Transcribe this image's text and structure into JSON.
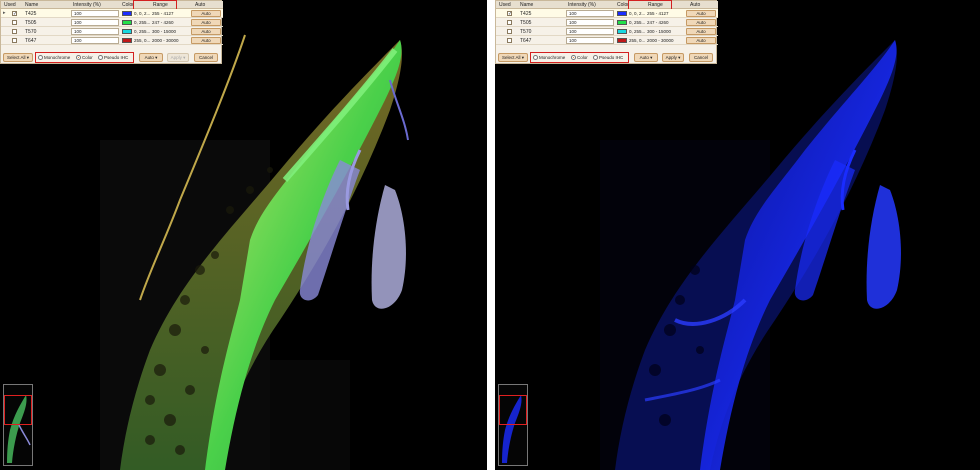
{
  "columns": {
    "used": "Used",
    "name": "Name",
    "intensity": "Intensity (%)",
    "color": "Color",
    "range": "Range",
    "auto": "Auto"
  },
  "panels": [
    {
      "id": "left",
      "rows": [
        {
          "name": "T425",
          "checked": true,
          "intensity": "100",
          "swatch": "#1a2cff",
          "color_value": "0, 0, 2...",
          "range": "255 - 4127",
          "auto": "Auto"
        },
        {
          "name": "T505",
          "checked": false,
          "intensity": "100",
          "swatch": "#22e04a",
          "color_value": "0, 255...",
          "range": "247 - 4260",
          "auto": "Auto"
        },
        {
          "name": "T570",
          "checked": false,
          "intensity": "100",
          "swatch": "#18d8e0",
          "color_value": "0, 255...",
          "range": "300 - 15000",
          "auto": "Auto"
        },
        {
          "name": "T647",
          "checked": false,
          "intensity": "100",
          "swatch": "#c01818",
          "color_value": "255, 0...",
          "range": "2000 - 30000",
          "auto": "Auto"
        }
      ],
      "radios": {
        "mono": "Monochrome",
        "color": "Color",
        "pseudo": "Pseudo IHC",
        "selected": "color"
      },
      "buttons": {
        "select_all": "Select All",
        "auto": "Auto",
        "apply": "Apply",
        "cancel": "Cancel"
      }
    },
    {
      "id": "right",
      "rows": [
        {
          "name": "T425",
          "checked": true,
          "intensity": "100",
          "swatch": "#1a2cff",
          "color_value": "0, 0, 2...",
          "range": "255 - 4127",
          "auto": "Auto"
        },
        {
          "name": "T505",
          "checked": false,
          "intensity": "100",
          "swatch": "#22e04a",
          "color_value": "0, 255...",
          "range": "247 - 4260",
          "auto": "Auto"
        },
        {
          "name": "T570",
          "checked": false,
          "intensity": "100",
          "swatch": "#18d8e0",
          "color_value": "0, 255...",
          "range": "300 - 15000",
          "auto": "Auto"
        },
        {
          "name": "T647",
          "checked": false,
          "intensity": "100",
          "swatch": "#c01818",
          "color_value": "255, 0...",
          "range": "2000 - 30000",
          "auto": "Auto"
        }
      ],
      "radios": {
        "mono": "Monochrome",
        "color": "Color",
        "pseudo": "Pseudo IHC",
        "selected": "color"
      },
      "buttons": {
        "select_all": "Select All",
        "auto": "Auto",
        "apply": "Apply",
        "cancel": "Cancel"
      }
    }
  ],
  "colors": {
    "background": "#000000",
    "tissue_left": "multichannel green-yellow-blue",
    "tissue_right": "#1a2cff",
    "highlight": "#d32020"
  }
}
